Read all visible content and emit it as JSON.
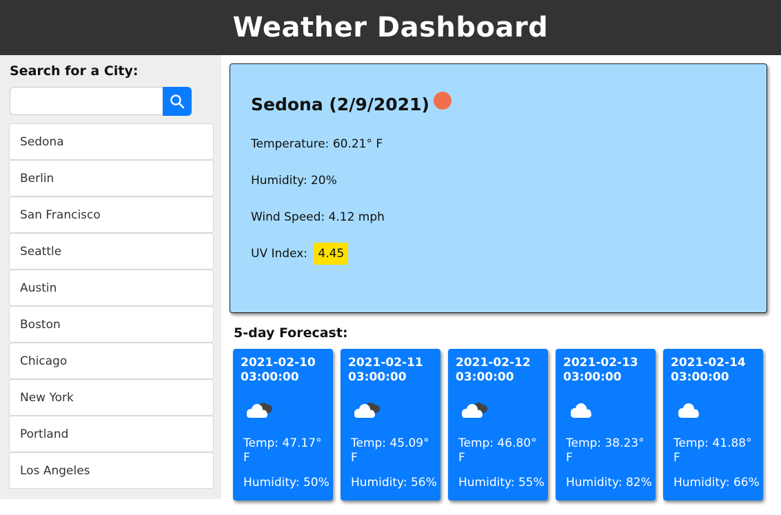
{
  "header": {
    "title": "Weather Dashboard"
  },
  "search": {
    "label": "Search for a City:",
    "value": "",
    "placeholder": ""
  },
  "cities": [
    "Sedona",
    "Berlin",
    "San Francisco",
    "Seattle",
    "Austin",
    "Boston",
    "Chicago",
    "New York",
    "Portland",
    "Los Angeles"
  ],
  "current": {
    "title": "Sedona (2/9/2021)",
    "icon": "sun-icon",
    "temperature": "Temperature: 60.21° F",
    "humidity": "Humidity: 20%",
    "wind": "Wind Speed: 4.12 mph",
    "uv_label": "UV Index:",
    "uv_value": "4.45",
    "uv_color": "#ffe000"
  },
  "forecast": {
    "label": "5-day Forecast:",
    "days": [
      {
        "date": "2021-02-10",
        "time": "03:00:00",
        "icon": "cloud-dark-icon",
        "temp": "Temp: 47.17° F",
        "humidity": "Humidity: 50%"
      },
      {
        "date": "2021-02-11",
        "time": "03:00:00",
        "icon": "cloud-dark-icon",
        "temp": "Temp: 45.09° F",
        "humidity": "Humidity: 56%"
      },
      {
        "date": "2021-02-12",
        "time": "03:00:00",
        "icon": "cloud-dark-icon",
        "temp": "Temp: 46.80° F",
        "humidity": "Humidity: 55%"
      },
      {
        "date": "2021-02-13",
        "time": "03:00:00",
        "icon": "cloud-icon",
        "temp": "Temp: 38.23° F",
        "humidity": "Humidity: 82%"
      },
      {
        "date": "2021-02-14",
        "time": "03:00:00",
        "icon": "cloud-icon",
        "temp": "Temp: 41.88° F",
        "humidity": "Humidity: 66%"
      }
    ]
  },
  "colors": {
    "header_bg": "#333333",
    "accent": "#0a7cff",
    "current_bg": "#a6dbfd",
    "sun": "#f0704d"
  }
}
